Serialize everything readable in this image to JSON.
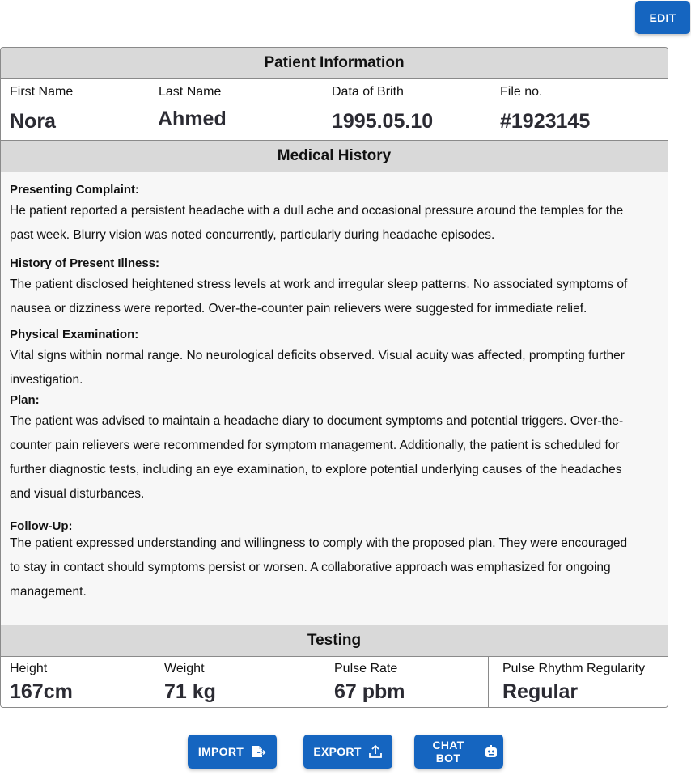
{
  "toolbar": {
    "edit_label": "EDIT"
  },
  "patient": {
    "header": "Patient Information",
    "first_name_label": "First Name",
    "first_name": "Nora",
    "last_name_label": "Last Name",
    "last_name": "Ahmed",
    "dob_label": "Data of Brith",
    "dob": "1995.05.10",
    "file_label": "File no.",
    "file_no": "#1923145"
  },
  "history": {
    "header": "Medical History",
    "sections": [
      {
        "heading": "Presenting Complaint:",
        "text": "He patient reported a persistent headache with a dull ache and occasional pressure around the temples for the past week. Blurry vision was noted concurrently, particularly during headache episodes."
      },
      {
        "heading": "History of Present Illness:",
        "text": "The patient disclosed heightened stress levels at work and irregular sleep patterns. No associated symptoms of nausea or dizziness were reported. Over-the-counter pain relievers were suggested for immediate relief."
      },
      {
        "heading": "Physical Examination:",
        "text": "Vital signs within normal range. No neurological deficits observed. Visual acuity was affected, prompting further investigation."
      },
      {
        "heading": "Plan:",
        "text": "The patient was advised to maintain a headache diary to document symptoms and potential triggers. Over-the-counter pain relievers were recommended for symptom management. Additionally, the patient is scheduled for further diagnostic tests, including an eye examination, to explore potential underlying causes of the headaches and visual disturbances."
      },
      {
        "heading": "Follow-Up:",
        "text": "The patient expressed understanding and willingness to comply with the proposed plan. They were encouraged to stay in contact should symptoms persist or worsen. A collaborative approach was emphasized for ongoing management."
      }
    ]
  },
  "testing": {
    "header": "Testing",
    "height_label": "Height",
    "height": "167cm",
    "weight_label": "Weight",
    "weight": "71 kg",
    "pulse_label": "Pulse Rate",
    "pulse": "67 pbm",
    "rhythm_label": "Pulse Rhythm Regularity",
    "rhythm": "Regular"
  },
  "actions": {
    "import_label": "IMPORT",
    "export_label": "EXPORT",
    "chatbot_label": "CHAT BOT"
  },
  "colors": {
    "accent": "#1565c0",
    "header_bg": "#d9d9d9",
    "card_bg": "#f7f7f7"
  },
  "icons": {
    "import": "file-import-icon",
    "export": "upload-icon",
    "chatbot": "robot-icon"
  }
}
